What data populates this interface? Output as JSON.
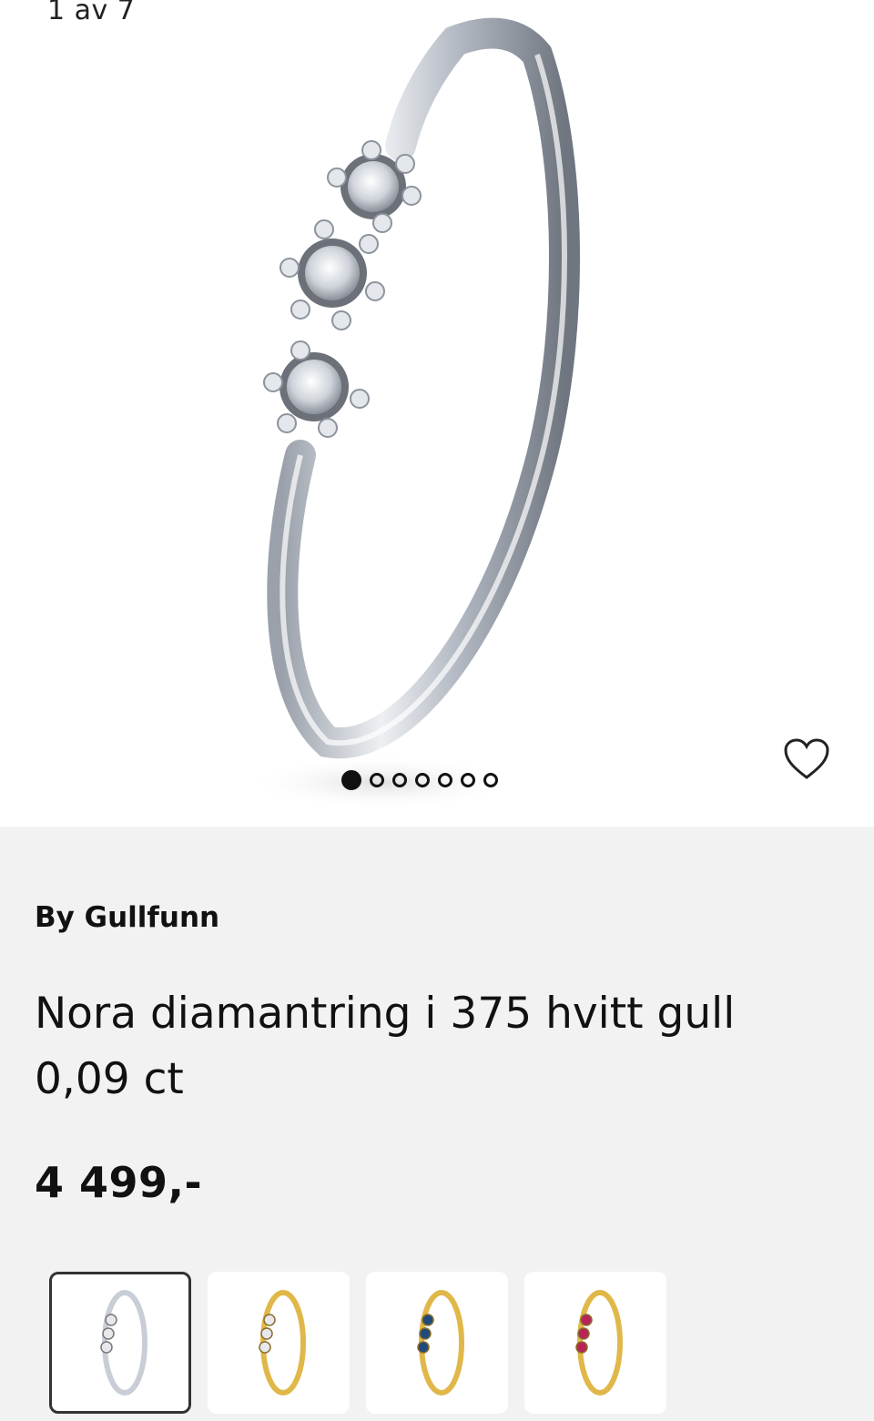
{
  "gallery": {
    "counter": "1 av 7",
    "image_count": 7,
    "active_index": 0,
    "favorite_icon": "heart-outline-icon"
  },
  "product": {
    "brand": "By Gullfunn",
    "title": "Nora diamantring i 375 hvitt gull 0,09 ct",
    "price": "4 499,-"
  },
  "variants": [
    {
      "metal": "white-gold",
      "stone": "diamond",
      "selected": true,
      "metal_color": "#c9ced6",
      "stone_color": "#e6e8ec"
    },
    {
      "metal": "yellow-gold",
      "stone": "diamond",
      "selected": false,
      "metal_color": "#e0b84a",
      "stone_color": "#e6e8ec"
    },
    {
      "metal": "yellow-gold",
      "stone": "sapphire",
      "selected": false,
      "metal_color": "#e0b84a",
      "stone_color": "#1f4a7a"
    },
    {
      "metal": "yellow-gold",
      "stone": "ruby",
      "selected": false,
      "metal_color": "#e0b84a",
      "stone_color": "#b8245a"
    }
  ]
}
